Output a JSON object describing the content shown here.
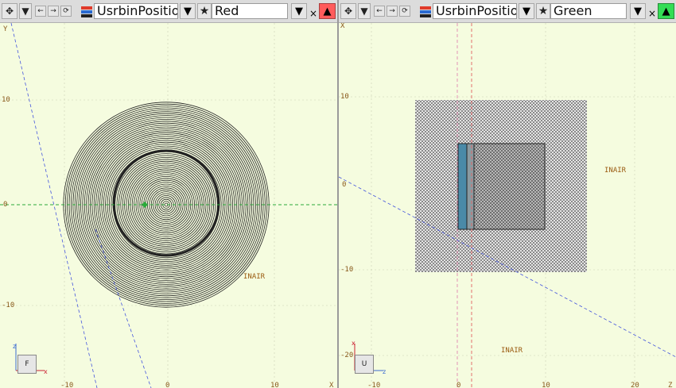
{
  "left": {
    "toolbar": {
      "move_icon": "move-cross-icon",
      "menu_arrow": "▼",
      "nav_back": "←",
      "nav_forward": "→",
      "refresh": "⟳",
      "layers_icon": "layers-icon",
      "usrbin_value": "UsrbinPositio",
      "star": "★",
      "color_value": "Red",
      "close": "×",
      "color_swatch": "#ff5b5b",
      "swatch_arrow": "▲"
    },
    "view": {
      "axis_v_label": "Y",
      "ticks_y": [
        "10",
        "0",
        "-10"
      ],
      "ticks_x": [
        "-10",
        "0",
        "10"
      ],
      "corner_x": "X",
      "material": "INAIR",
      "axis_box": "F",
      "axis_x": "x",
      "axis_z": "z"
    }
  },
  "right": {
    "toolbar": {
      "move_icon": "move-cross-icon",
      "menu_arrow": "▼",
      "nav_back": "←",
      "nav_forward": "→",
      "refresh": "⟳",
      "layers_icon": "layers-icon",
      "usrbin_value": "UsrbinPositio",
      "star": "★",
      "color_value": "Green",
      "close": "×",
      "color_swatch": "#33dd55",
      "swatch_arrow": "▲"
    },
    "view": {
      "axis_v_label": "X",
      "ticks_y": [
        "10",
        "0",
        "-10",
        "-20"
      ],
      "ticks_x": [
        "-10",
        "0",
        "10",
        "20"
      ],
      "corner_z": "Z",
      "material_top": "INAIR",
      "material_bottom": "INAIR",
      "axis_box": "U",
      "axis_x": "x",
      "axis_z": "z"
    }
  }
}
